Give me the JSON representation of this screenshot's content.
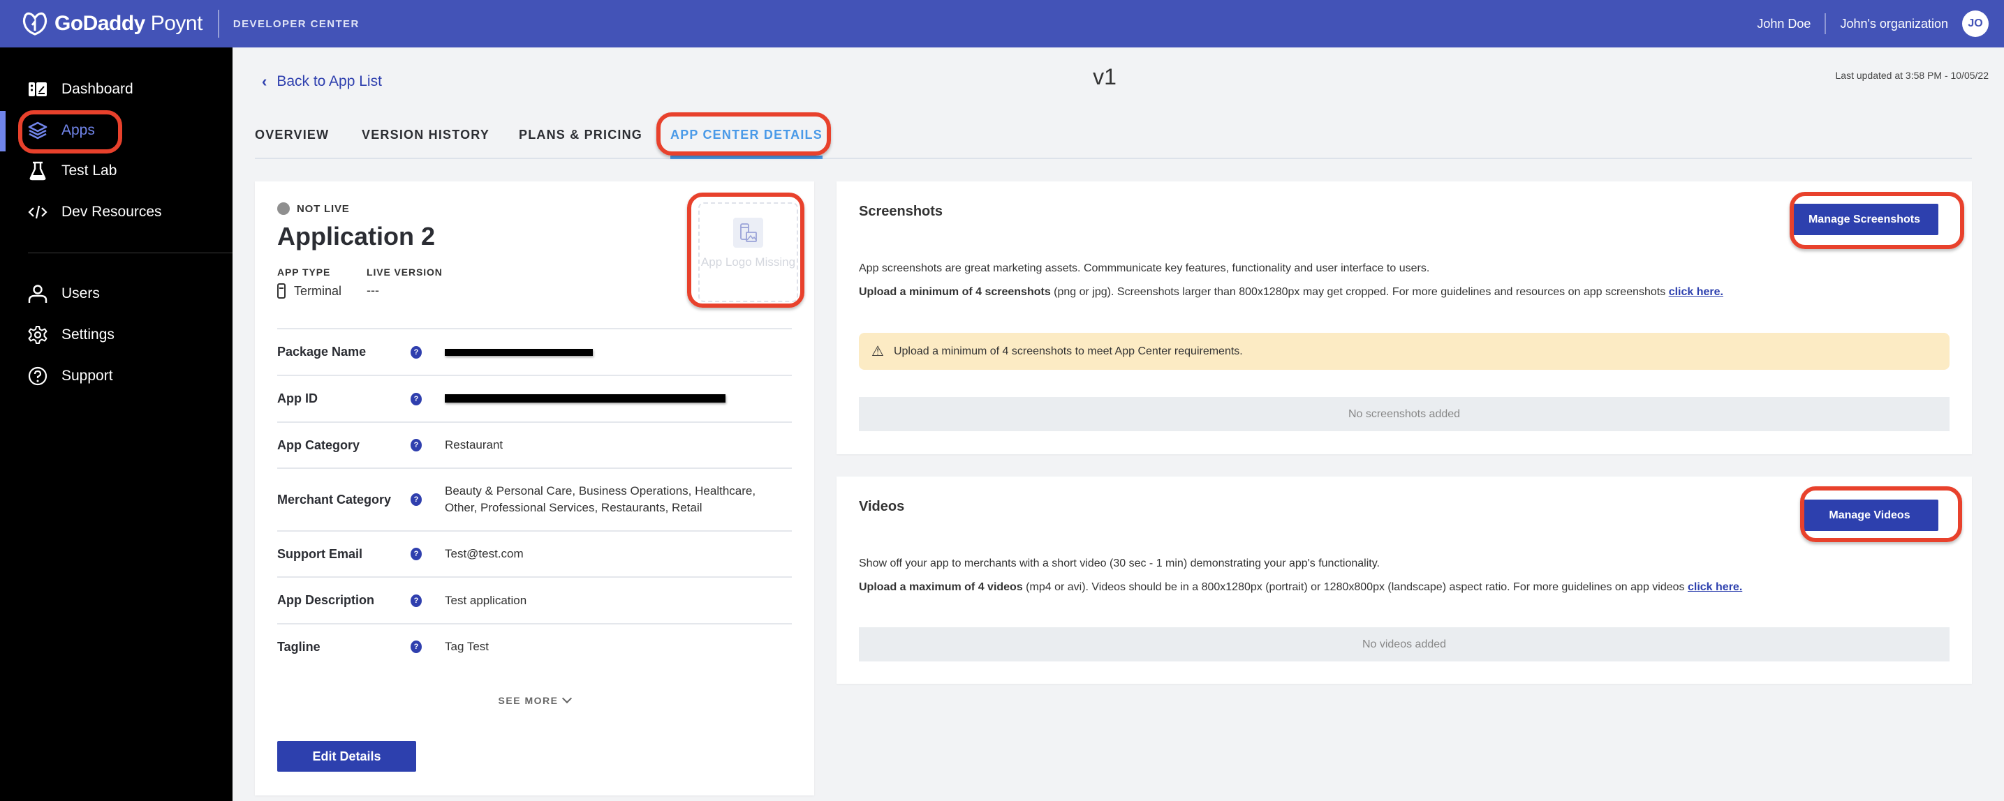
{
  "header": {
    "brand_bold": "GoDaddy",
    "brand_light": "Poynt",
    "subtitle": "DEVELOPER CENTER",
    "user_name": "John Doe",
    "organization": "John's organization",
    "avatar_initials": "JO"
  },
  "sidebar": {
    "items": [
      {
        "label": "Dashboard",
        "icon": "dashboard-icon",
        "active": false
      },
      {
        "label": "Apps",
        "icon": "layers-icon",
        "active": true
      },
      {
        "label": "Test Lab",
        "icon": "flask-icon",
        "active": false
      },
      {
        "label": "Dev Resources",
        "icon": "code-icon",
        "active": false
      },
      {
        "label": "Users",
        "icon": "user-icon",
        "active": false
      },
      {
        "label": "Settings",
        "icon": "gear-icon",
        "active": false
      },
      {
        "label": "Support",
        "icon": "help-circle-icon",
        "active": false
      }
    ]
  },
  "page": {
    "back_label": "Back to App List",
    "version_title": "v1",
    "last_updated": "Last updated at 3:58 PM - 10/05/22",
    "tabs": [
      {
        "label": "OVERVIEW",
        "active": false
      },
      {
        "label": "VERSION HISTORY",
        "active": false
      },
      {
        "label": "PLANS & PRICING",
        "active": false
      },
      {
        "label": "APP CENTER DETAILS",
        "active": true
      }
    ]
  },
  "app": {
    "status": "NOT LIVE",
    "name": "Application 2",
    "app_type_label": "APP TYPE",
    "app_type_value": "Terminal",
    "live_version_label": "LIVE VERSION",
    "live_version_value": "---",
    "logo_missing_text": "App Logo Missing",
    "fields": [
      {
        "label": "Package Name",
        "value": "[redacted]",
        "redacted": true
      },
      {
        "label": "App ID",
        "value": "[redacted]",
        "redacted": true
      },
      {
        "label": "App Category",
        "value": "Restaurant"
      },
      {
        "label": "Merchant Category",
        "value": "Beauty & Personal Care, Business Operations, Healthcare, Other, Professional Services, Restaurants, Retail"
      },
      {
        "label": "Support Email",
        "value": "Test@test.com"
      },
      {
        "label": "App Description",
        "value": "Test application"
      },
      {
        "label": "Tagline",
        "value": "Tag Test"
      }
    ],
    "see_more_label": "SEE MORE",
    "edit_button_label": "Edit Details"
  },
  "screenshots": {
    "title": "Screenshots",
    "manage_button_label": "Manage Screenshots",
    "description": "App screenshots are great marketing assets. Commmunicate key features, functionality and user interface to users.",
    "requirement_bold": "Upload a minimum of 4 screenshots",
    "requirement_rest": " (png or jpg). Screenshots larger than 800x1280px may get cropped. For more guidelines and resources on app screenshots ",
    "link_label": "click here.",
    "warning_text": "Upload a minimum of 4 screenshots to meet App Center requirements.",
    "empty_text": "No screenshots added"
  },
  "videos": {
    "title": "Videos",
    "manage_button_label": "Manage Videos",
    "description": "Show off your app to merchants with a short video (30 sec - 1 min) demonstrating your app's functionality.",
    "requirement_bold": "Upload a maximum of 4 videos",
    "requirement_rest": " (mp4 or avi). Videos should be in a 800x1280px (portrait) or 1280x800px (landscape) aspect ratio. For more guidelines on app videos ",
    "link_label": "click here.",
    "empty_text": "No videos added"
  },
  "colors": {
    "header_bg": "#4353b7",
    "primary_button": "#2d40ae",
    "active_tab": "#4a9ae8",
    "active_nav": "#7185ea",
    "warning_bg": "#fcebc4",
    "annotation": "#e8412c"
  }
}
